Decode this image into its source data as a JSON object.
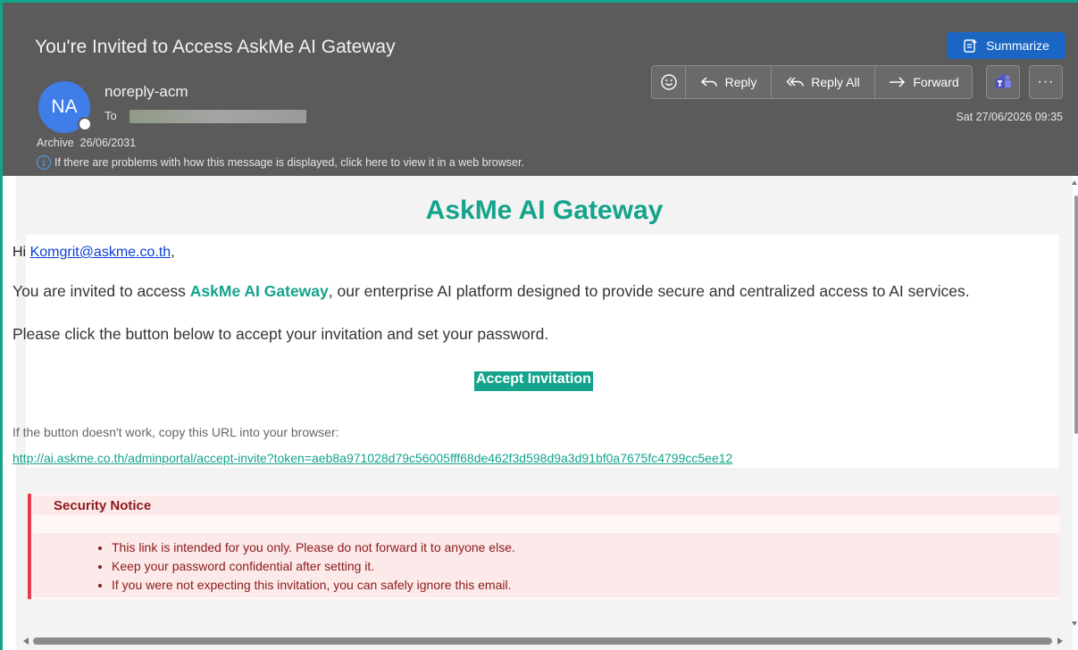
{
  "header": {
    "subject": "You're Invited to Access AskMe AI Gateway",
    "summarize_label": "Summarize",
    "sender_initials": "NA",
    "sender_name": "noreply-acm",
    "to_label": "To",
    "archive_label": "Archive",
    "archive_date": "26/06/2031",
    "info_text": "If there are problems with how this message is displayed, click here to view it in a web browser.",
    "received": "Sat 27/06/2026 09:35",
    "toolbar": {
      "reply": "Reply",
      "reply_all": "Reply All",
      "forward": "Forward",
      "more": "···"
    },
    "colors": {
      "header_bg": "#5b5b5b",
      "summarize_bg": "#1a66c2",
      "avatar_bg": "#3f7ee8"
    },
    "icons": [
      "smiley-icon",
      "reply-icon",
      "reply-all-icon",
      "forward-icon",
      "teams-icon",
      "more-icon",
      "summarize-icon",
      "info-icon"
    ]
  },
  "email": {
    "brand_title": "AskMe AI Gateway",
    "greeting_prefix": "Hi ",
    "greeting_email": "Komgrit@askme.co.th",
    "greeting_suffix": ",",
    "p1_prefix": "You are invited to access ",
    "p1_brand": "AskMe AI Gateway",
    "p1_suffix": ", our enterprise AI platform designed to provide secure and centralized access to AI services.",
    "p2": "Please click the button below to accept your invitation and set your password.",
    "accept_button": "Accept Invitation",
    "fallback_text": "If the button doesn't work, copy this URL into your browser:",
    "url": "http://ai.askme.co.th/adminportal/accept-invite?token=aeb8a971028d79c56005fff68de462f3d598d9a3d91bf0a7675fc4799cc5ee12",
    "security": {
      "title": "Security Notice",
      "items": [
        "This link is intended for you only. Please do not forward it to anyone else.",
        "Keep your password confidential after setting it.",
        "If you were not expecting this invitation, you can safely ignore this email."
      ]
    },
    "colors": {
      "brand": "#14a38b",
      "notice_text": "#8b1a1a",
      "notice_border": "#e53e4f",
      "link": "#0b3fd6"
    }
  }
}
